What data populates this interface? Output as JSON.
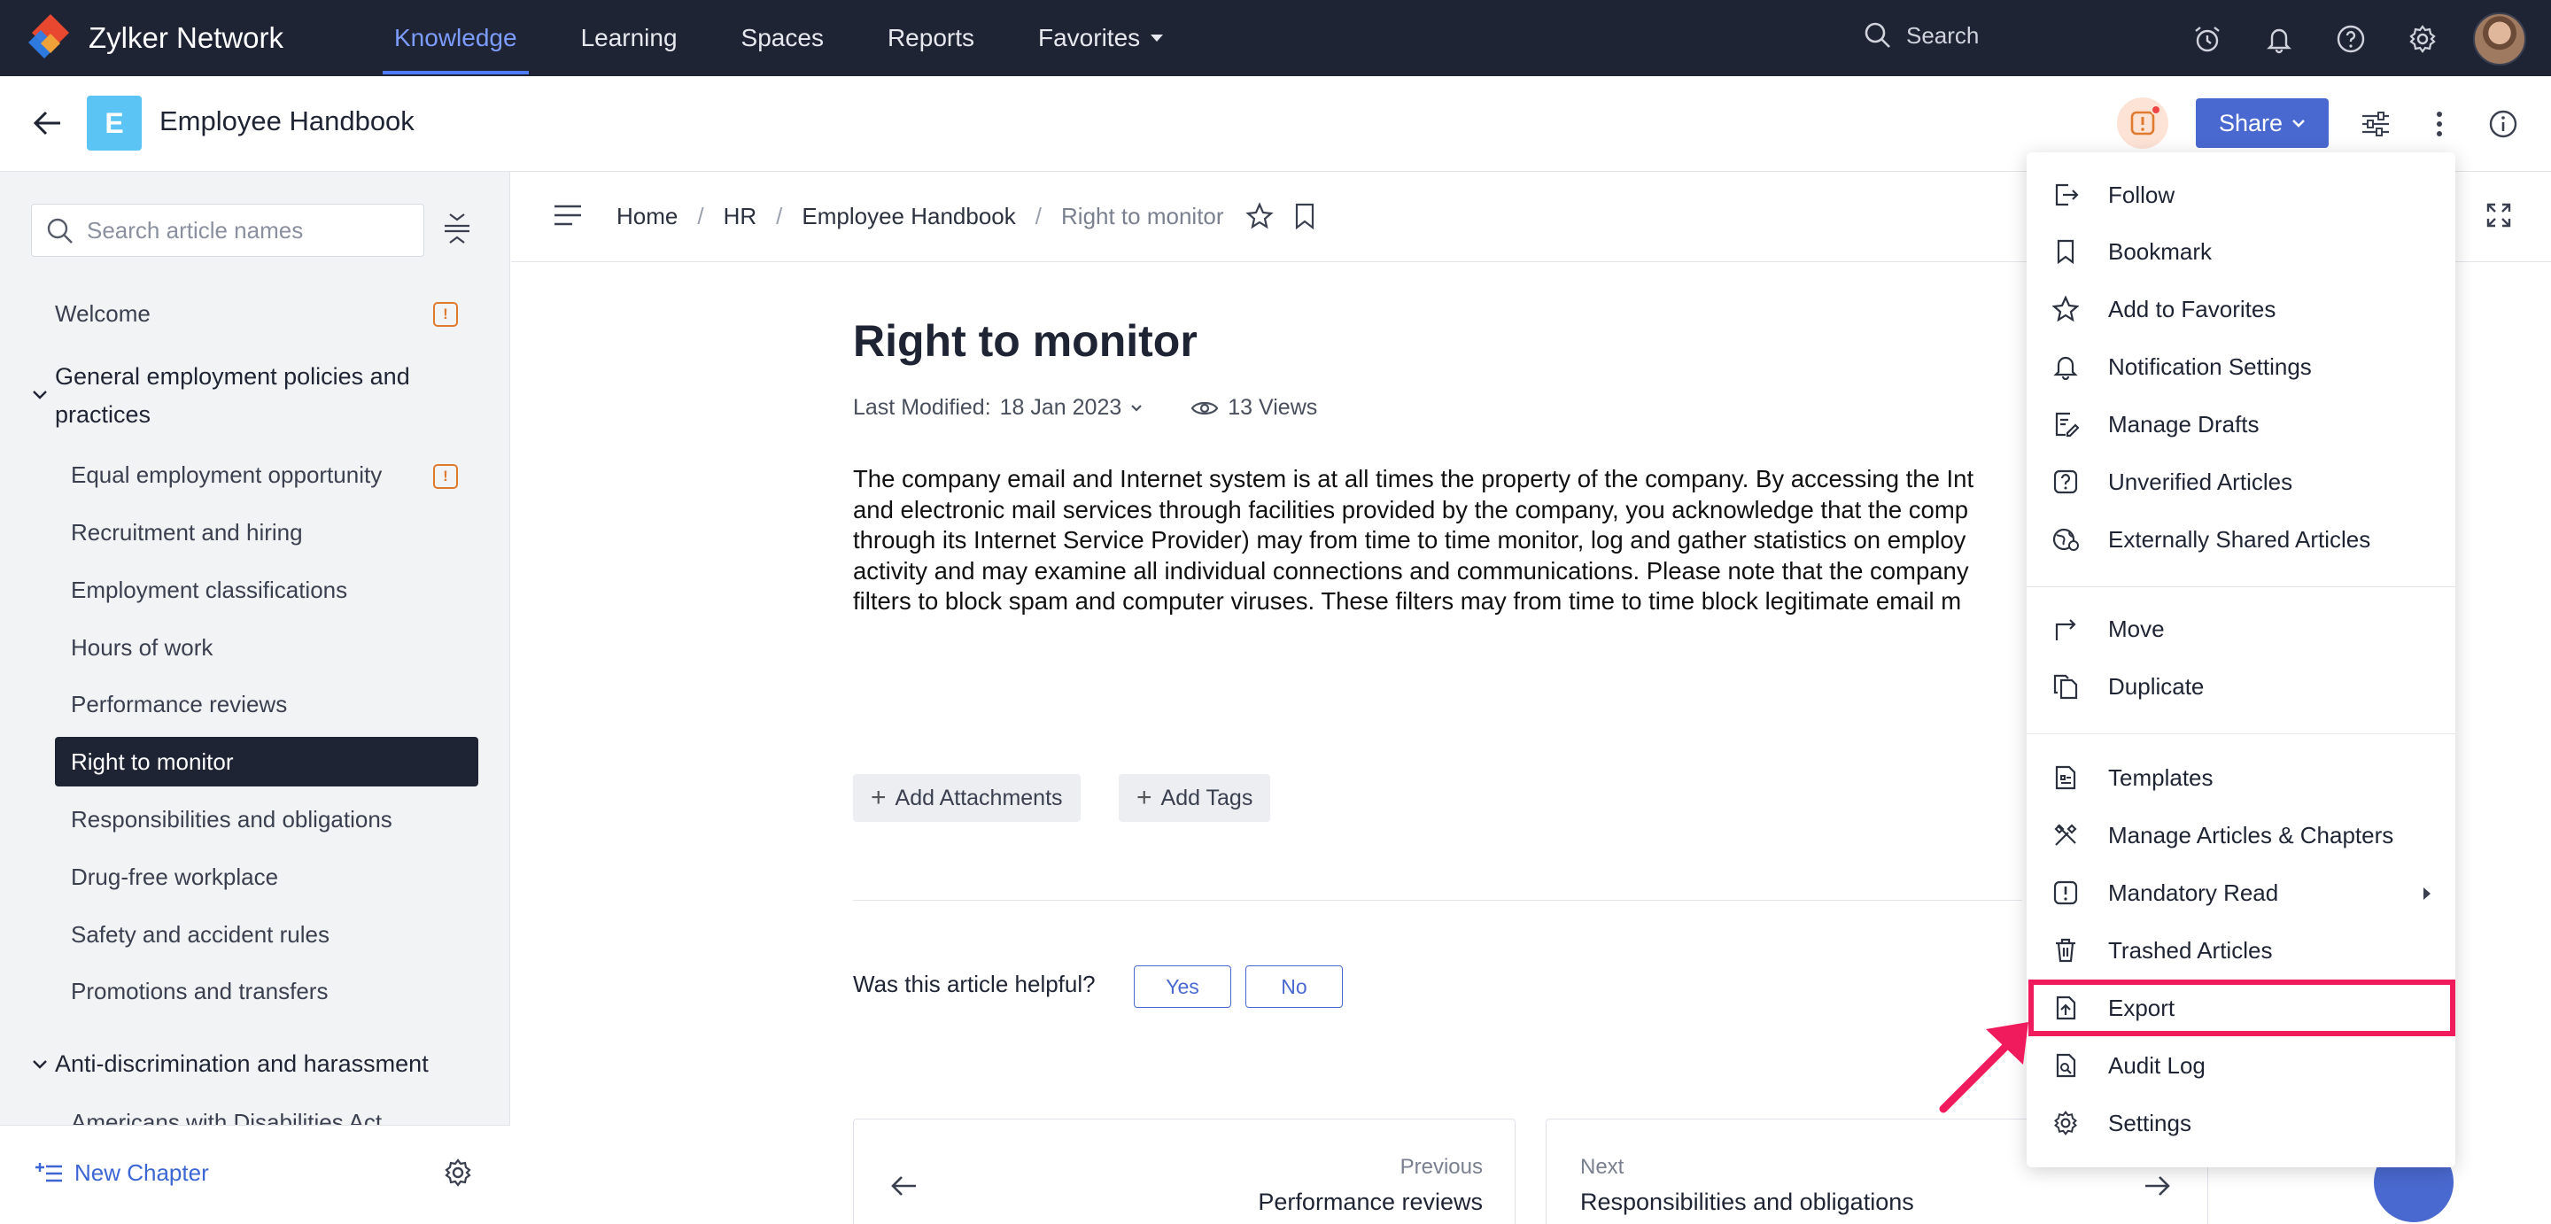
{
  "app": {
    "brand": "Zylker Network",
    "nav": [
      {
        "label": "Knowledge",
        "active": true
      },
      {
        "label": "Learning"
      },
      {
        "label": "Spaces"
      },
      {
        "label": "Reports"
      },
      {
        "label": "Favorites"
      }
    ],
    "search_label": "Search",
    "accent_color": "#4a69d0"
  },
  "header": {
    "badge_letter": "E",
    "title": "Employee Handbook",
    "share_label": "Share"
  },
  "sidebar": {
    "search_placeholder": "Search article names",
    "welcome": "Welcome",
    "section1": "General employment policies and",
    "section1_line2": "practices",
    "items": [
      "Equal employment opportunity",
      "Recruitment and hiring",
      "Employment classifications",
      "Hours of work",
      "Performance reviews",
      "Right to monitor",
      "Responsibilities and obligations",
      "Drug-free workplace",
      "Safety and accident rules",
      "Promotions and transfers"
    ],
    "section2": "Anti-discrimination and harassment",
    "partial_item": "Americans with Disabilities Act",
    "new_chapter": "New Chapter"
  },
  "breadcrumb": {
    "items": [
      "Home",
      "HR",
      "Employee Handbook",
      "Right to monitor"
    ]
  },
  "article": {
    "title": "Right to monitor",
    "last_modified_label": "Last Modified:",
    "last_modified": "18 Jan 2023",
    "views": "13 Views",
    "body_lines": [
      "The company email and Internet system is at all times the property of the company. By accessing the Int",
      "and electronic mail services through facilities provided by the company, you acknowledge that the comp",
      "through its Internet Service Provider) may from time to time monitor, log and gather statistics on employ",
      "activity and may examine all individual connections and communications. Please note that the company",
      "filters to block spam and computer viruses. These filters may from time to time block legitimate email m"
    ],
    "add_attachments": "Add Attachments",
    "add_tags": "Add Tags",
    "helpful_q": "Was this article helpful?",
    "yes": "Yes",
    "no": "No",
    "prev_label": "Previous",
    "prev_title": "Performance reviews",
    "next_label": "Next",
    "next_title": "Responsibilities and obligations"
  },
  "menu": {
    "group1": [
      "Follow",
      "Bookmark",
      "Add to Favorites",
      "Notification Settings",
      "Manage Drafts",
      "Unverified Articles",
      "Externally Shared Articles"
    ],
    "group2": [
      "Move",
      "Duplicate"
    ],
    "group3": [
      "Templates",
      "Manage Articles & Chapters",
      "Mandatory Read",
      "Trashed Articles",
      "Export",
      "Audit Log",
      "Settings"
    ],
    "highlight_color": "#ef1b5c"
  }
}
